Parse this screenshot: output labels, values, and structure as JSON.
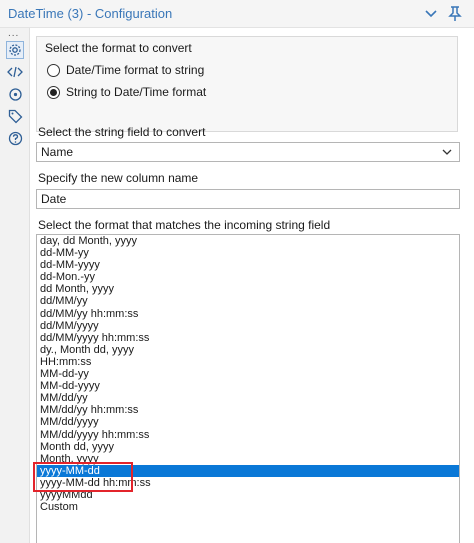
{
  "window": {
    "title": "DateTime (3) - Configuration",
    "title_color": "#3a77b8"
  },
  "sidebar": {
    "dots": "...",
    "icons": [
      "gear-icon",
      "code-icon",
      "target-icon",
      "tag-icon",
      "help-icon"
    ]
  },
  "mode": {
    "label": "Select the format to convert",
    "options": [
      {
        "label": "Date/Time format to string",
        "checked": false
      },
      {
        "label": "String to Date/Time format",
        "checked": true
      }
    ]
  },
  "string_field": {
    "label": "Select the string field to convert",
    "value": "Name"
  },
  "new_column": {
    "label": "Specify the new column name",
    "value": "Date"
  },
  "format_list": {
    "label": "Select the format that matches the incoming string field",
    "items": [
      "day, dd Month, yyyy",
      "dd-MM-yy",
      "dd-MM-yyyy",
      "dd-Mon.-yy",
      "dd Month, yyyy",
      "dd/MM/yy",
      "dd/MM/yy hh:mm:ss",
      "dd/MM/yyyy",
      "dd/MM/yyyy hh:mm:ss",
      "dy., Month dd, yyyy",
      "HH:mm:ss",
      "MM-dd-yy",
      "MM-dd-yyyy",
      "MM/dd/yy",
      "MM/dd/yy hh:mm:ss",
      "MM/dd/yyyy",
      "MM/dd/yyyy hh:mm:ss",
      "Month dd, yyyy",
      "Month, yyyy",
      "yyyy-MM-dd",
      "yyyy-MM-dd hh:mm:ss",
      "yyyyMMdd",
      "Custom"
    ],
    "selected": "yyyy-MM-dd",
    "selection_color": "#0a78d7"
  },
  "annotation": {
    "color": "#e3242b"
  }
}
